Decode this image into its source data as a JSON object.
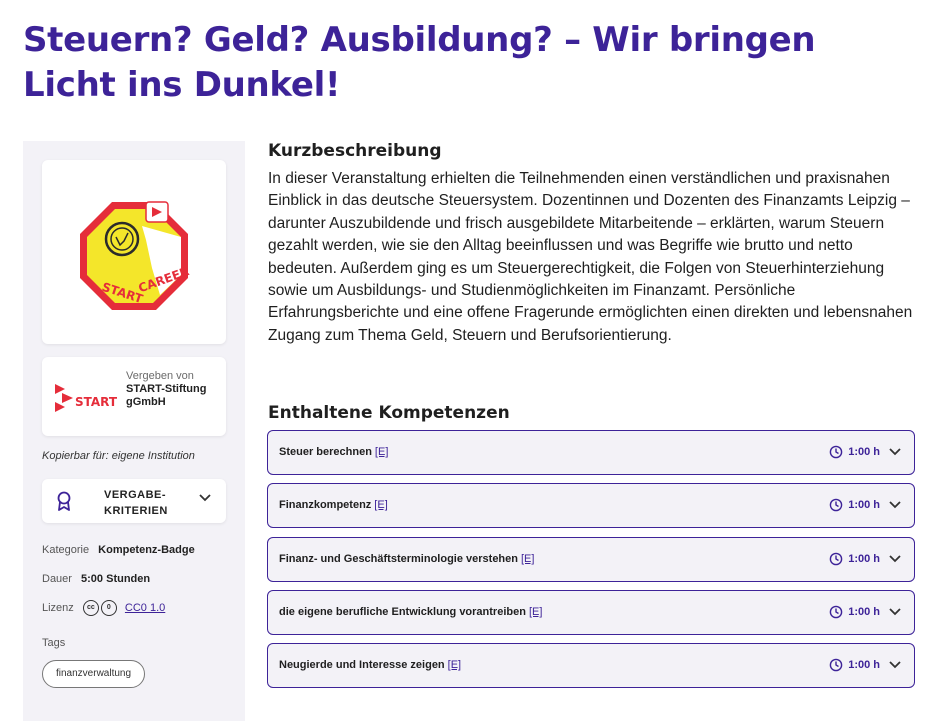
{
  "page_title": "Steuern? Geld? Ausbildung? – Wir bringen Licht ins Dunkel!",
  "badge": {
    "icon": "start-career-badge",
    "text_start": "START",
    "text_career": "CAREER"
  },
  "issuer": {
    "caption": "Vergeben von",
    "name": "START-Stiftung gGmbH",
    "logo_text": "START"
  },
  "copyable": "Kopierbar für: eigene Institution",
  "criteria": {
    "label": "VERGABE-KRITERIEN",
    "icon": "award-ribbon-icon"
  },
  "meta": {
    "category_label": "Kategorie",
    "category_value": "Kompetenz-Badge",
    "duration_label": "Dauer",
    "duration_value": "5:00 Stunden",
    "license_label": "Lizenz",
    "license_value": "CC0 1.0",
    "tags_label": "Tags"
  },
  "tags": [
    "finanzverwaltung"
  ],
  "description": {
    "heading": "Kurzbeschreibung",
    "text": "In dieser Veranstaltung erhielten die Teilnehmenden einen verständlichen und praxisnahen Einblick in das deutsche Steuersystem. Dozentinnen und Dozenten des Finanzamts Leipzig – darunter Auszubildende und frisch ausgebildete Mitarbeitende – erklärten, warum Steuern gezahlt werden, wie sie den Alltag beeinflussen und was Begriffe wie brutto und netto bedeuten. Außerdem ging es um Steuergerechtigkeit, die Folgen von Steuerhinterziehung sowie um Ausbildungs- und Studienmöglichkeiten im Finanzamt. Persönliche Erfahrungsberichte und eine offene Fragerunde ermöglichten einen direkten und lebensnahen Zugang zum Thema Geld, Steuern und Berufsorientierung."
  },
  "competencies": {
    "heading": "Enthaltene Kompetenzen",
    "items": [
      {
        "name": "Steuer berechnen",
        "tag": "[E]",
        "duration": "1:00 h"
      },
      {
        "name": "Finanzkompetenz",
        "tag": "[E]",
        "duration": "1:00 h"
      },
      {
        "name": "Finanz- und Geschäftsterminologie verstehen",
        "tag": "[E]",
        "duration": "1:00 h"
      },
      {
        "name": "die eigene berufliche Entwicklung vorantreiben",
        "tag": "[E]",
        "duration": "1:00 h"
      },
      {
        "name": "Neugierde und Interesse zeigen",
        "tag": "[E]",
        "duration": "1:00 h"
      }
    ]
  },
  "colors": {
    "primary": "#3d2398",
    "sidebar_bg": "#f3f2f7",
    "badge_red": "#e52d3a",
    "badge_yellow": "#f4e62a"
  }
}
